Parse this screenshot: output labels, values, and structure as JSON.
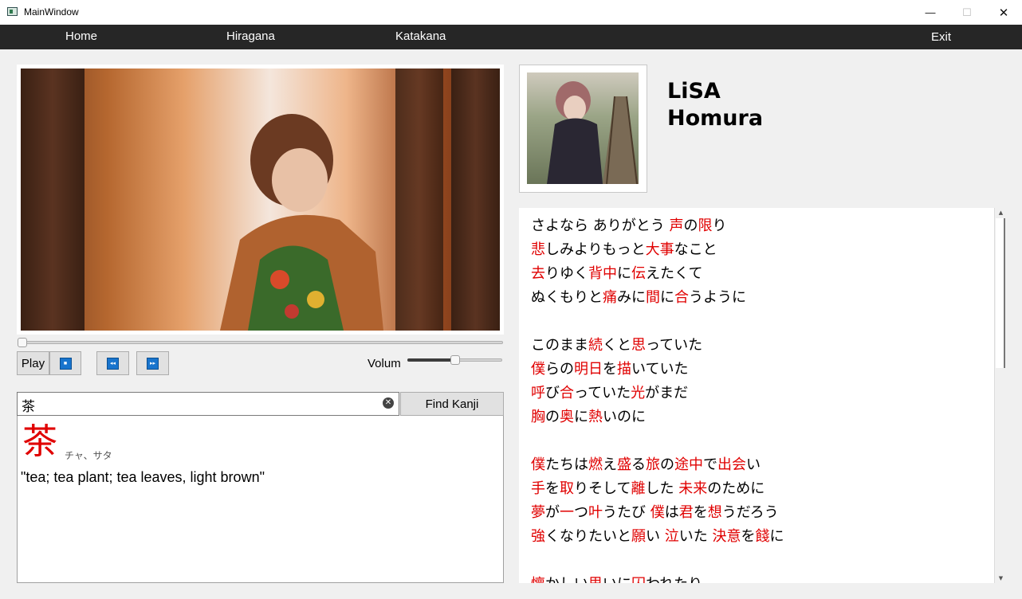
{
  "window": {
    "title": "MainWindow",
    "minimize": "—",
    "maximize": "☐",
    "close": "✕"
  },
  "menu": {
    "home": "Home",
    "hiragana": "Hiragana",
    "katakana": "Katakana",
    "exit": "Exit"
  },
  "player": {
    "play_label": "Play",
    "stop_icon": "■",
    "rewind_icon": "◂◂",
    "forward_icon": "▸▸",
    "volume_label": "Volume",
    "seek_fraction": 0.0,
    "volume_fraction": 0.5
  },
  "search": {
    "value": "茶",
    "clear_icon": "✕",
    "button_label": "Find Kanji"
  },
  "kanji": {
    "character": "茶",
    "reading": "チャ、サタ",
    "meaning": "\"tea; tea plant; tea leaves, light brown\""
  },
  "song": {
    "artist": "LiSA",
    "title": "Homura"
  },
  "lyrics": [
    [
      [
        "さよなら ありがとう ",
        false
      ],
      [
        "声",
        true
      ],
      [
        "の",
        false
      ],
      [
        "限",
        true
      ],
      [
        "り",
        false
      ]
    ],
    [
      [
        "悲",
        true
      ],
      [
        "しみよりもっと",
        false
      ],
      [
        "大事",
        true
      ],
      [
        "なこと",
        false
      ]
    ],
    [
      [
        "去",
        true
      ],
      [
        "りゆく",
        false
      ],
      [
        "背中",
        true
      ],
      [
        "に",
        false
      ],
      [
        "伝",
        true
      ],
      [
        "えたくて",
        false
      ]
    ],
    [
      [
        "ぬくもりと",
        false
      ],
      [
        "痛",
        true
      ],
      [
        "みに",
        false
      ],
      [
        "間",
        true
      ],
      [
        "に",
        false
      ],
      [
        "合",
        true
      ],
      [
        "うように",
        false
      ]
    ],
    [],
    [
      [
        "このまま",
        false
      ],
      [
        "続",
        true
      ],
      [
        "くと",
        false
      ],
      [
        "思",
        true
      ],
      [
        "っていた",
        false
      ]
    ],
    [
      [
        "僕",
        true
      ],
      [
        "らの",
        false
      ],
      [
        "明日",
        true
      ],
      [
        "を",
        false
      ],
      [
        "描",
        true
      ],
      [
        "いていた",
        false
      ]
    ],
    [
      [
        "呼",
        true
      ],
      [
        "び",
        false
      ],
      [
        "合",
        true
      ],
      [
        "っていた",
        false
      ],
      [
        "光",
        true
      ],
      [
        "がまだ",
        false
      ]
    ],
    [
      [
        "胸",
        true
      ],
      [
        "の",
        false
      ],
      [
        "奥",
        true
      ],
      [
        "に",
        false
      ],
      [
        "熱",
        true
      ],
      [
        "いのに",
        false
      ]
    ],
    [],
    [
      [
        "僕",
        true
      ],
      [
        "たちは",
        false
      ],
      [
        "燃",
        true
      ],
      [
        "え",
        false
      ],
      [
        "盛",
        true
      ],
      [
        "る",
        false
      ],
      [
        "旅",
        true
      ],
      [
        "の",
        false
      ],
      [
        "途中",
        true
      ],
      [
        "で",
        false
      ],
      [
        "出会",
        true
      ],
      [
        "い",
        false
      ]
    ],
    [
      [
        "手",
        true
      ],
      [
        "を",
        false
      ],
      [
        "取",
        true
      ],
      [
        "りそして",
        false
      ],
      [
        "離",
        true
      ],
      [
        "した ",
        false
      ],
      [
        "未来",
        true
      ],
      [
        "のために",
        false
      ]
    ],
    [
      [
        "夢",
        true
      ],
      [
        "が",
        false
      ],
      [
        "一",
        true
      ],
      [
        "つ",
        false
      ],
      [
        "叶",
        true
      ],
      [
        "うたび ",
        false
      ],
      [
        "僕",
        true
      ],
      [
        "は",
        false
      ],
      [
        "君",
        true
      ],
      [
        "を",
        false
      ],
      [
        "想",
        true
      ],
      [
        "うだろう",
        false
      ]
    ],
    [
      [
        "強",
        true
      ],
      [
        "くなりたいと",
        false
      ],
      [
        "願",
        true
      ],
      [
        "い ",
        false
      ],
      [
        "泣",
        true
      ],
      [
        "いた ",
        false
      ],
      [
        "決意",
        true
      ],
      [
        "を",
        false
      ],
      [
        "餞",
        true
      ],
      [
        "に",
        false
      ]
    ],
    [],
    [
      [
        "懐",
        true
      ],
      [
        "かしい",
        false
      ],
      [
        "思",
        true
      ],
      [
        "いに",
        false
      ],
      [
        "囚",
        true
      ],
      [
        "われたり",
        false
      ]
    ]
  ],
  "colors": {
    "menubar": "#262626",
    "kanji_highlight": "#e00000"
  }
}
